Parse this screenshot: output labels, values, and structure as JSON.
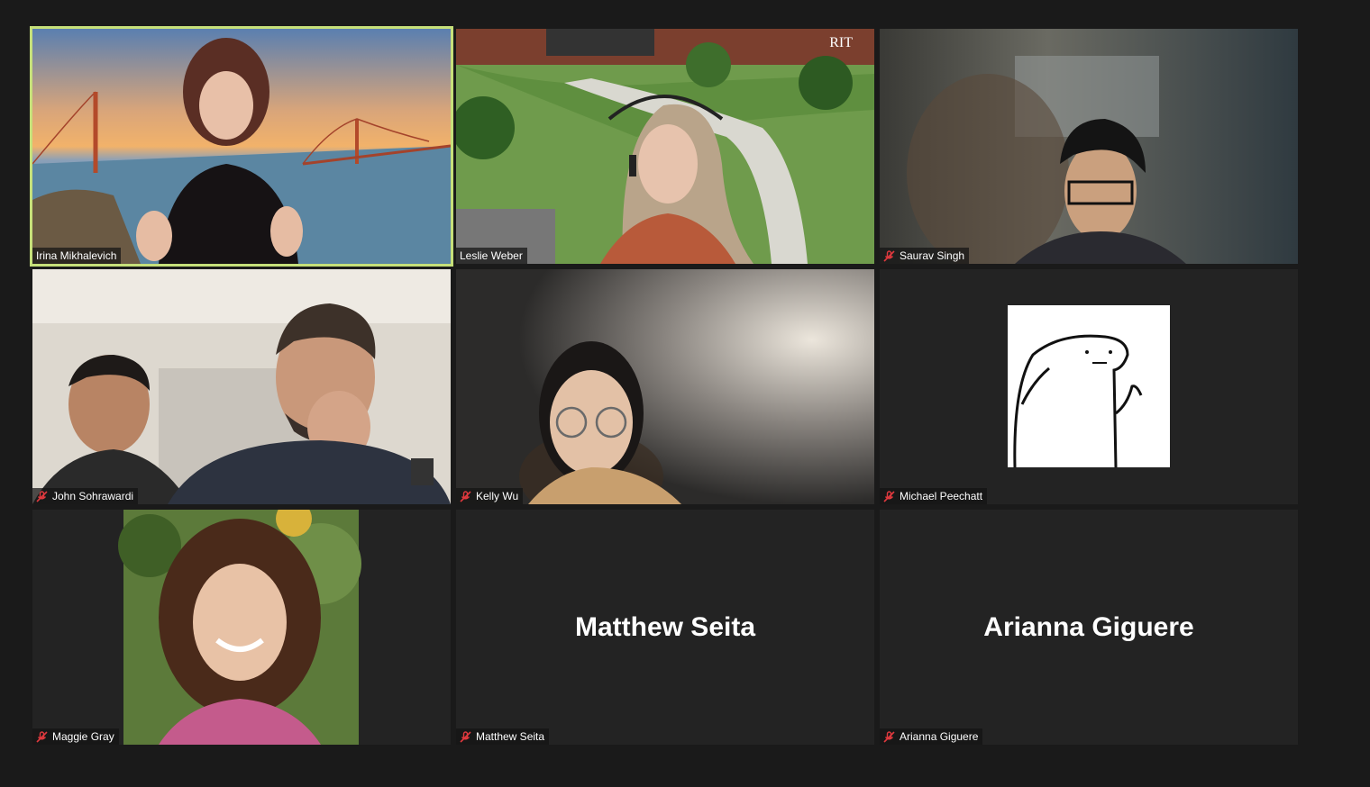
{
  "app": {
    "theme_bg": "#1a1a1a",
    "active_speaker_color": "#c6e07a",
    "mute_color": "#e0393e"
  },
  "participants": [
    {
      "name": "Irina Mikhalevich",
      "muted": false,
      "active": true,
      "video": "on"
    },
    {
      "name": "Leslie Weber",
      "muted": false,
      "active": false,
      "video": "on",
      "background_logo": "RIT"
    },
    {
      "name": "Saurav Singh",
      "muted": true,
      "active": false,
      "video": "on"
    },
    {
      "name": "John Sohrawardi",
      "muted": true,
      "active": false,
      "video": "on"
    },
    {
      "name": "Kelly Wu",
      "muted": true,
      "active": false,
      "video": "on"
    },
    {
      "name": "Michael Peechatt",
      "muted": true,
      "active": false,
      "video": "avatar"
    },
    {
      "name": "Maggie Gray",
      "muted": true,
      "active": false,
      "video": "on"
    },
    {
      "name": "Matthew Seita",
      "muted": true,
      "active": false,
      "video": "off",
      "display_name": "Matthew Seita"
    },
    {
      "name": "Arianna Giguere",
      "muted": true,
      "active": false,
      "video": "off",
      "display_name": "Arianna Giguere"
    }
  ]
}
